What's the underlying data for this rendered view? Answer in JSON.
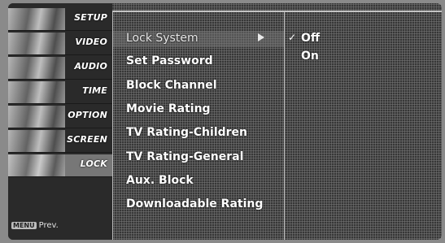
{
  "categories": [
    {
      "label": "SETUP"
    },
    {
      "label": "VIDEO"
    },
    {
      "label": "AUDIO"
    },
    {
      "label": "TIME"
    },
    {
      "label": "OPTION"
    },
    {
      "label": "SCREEN"
    },
    {
      "label": "LOCK"
    }
  ],
  "active_category": "LOCK",
  "footer": {
    "menu_key": "MENU",
    "prev_label": "Prev."
  },
  "submenu": {
    "items": [
      {
        "label": "Lock System"
      },
      {
        "label": "Set Password"
      },
      {
        "label": "Block Channel"
      },
      {
        "label": "Movie Rating"
      },
      {
        "label": "TV Rating-Children"
      },
      {
        "label": "TV Rating-General"
      },
      {
        "label": "Aux. Block"
      },
      {
        "label": "Downloadable Rating"
      }
    ],
    "selected": "Lock System"
  },
  "options": {
    "items": [
      {
        "label": "Off",
        "checked": true
      },
      {
        "label": "On",
        "checked": false
      }
    ]
  },
  "icons": {
    "check": "check-icon",
    "arrow": "arrow-right-icon"
  }
}
